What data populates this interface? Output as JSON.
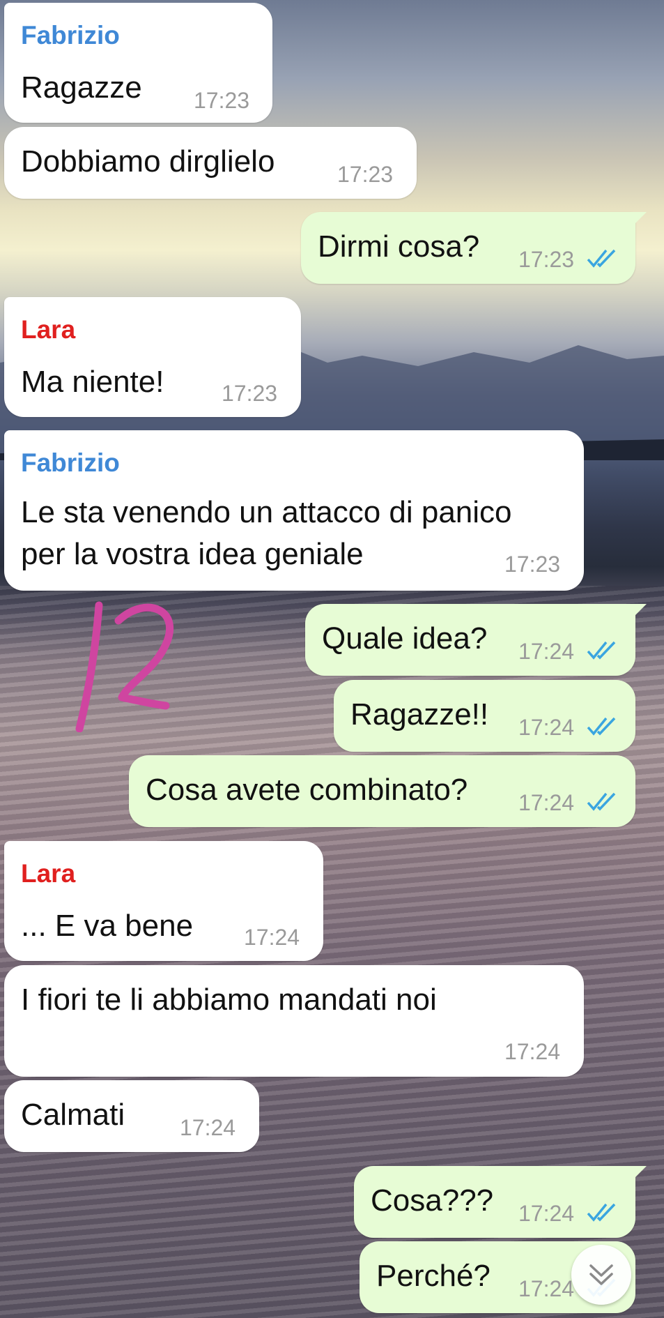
{
  "colors": {
    "fabrizio": "#3f88d6",
    "lara": "#e0201f",
    "incoming_bubble": "#ffffff",
    "outgoing_bubble": "#e7fcd5",
    "read_ticks": "#3aa5e0",
    "annotation": "#cf45a0"
  },
  "annotation": {
    "icon": "handwritten-12-annotation"
  },
  "messages": [
    {
      "sender": "Fabrizio",
      "text": "Ragazze",
      "time": "17:23"
    },
    {
      "text": "Dobbiamo dirglielo",
      "time": "17:23"
    },
    {
      "text": "Dirmi cosa?",
      "time": "17:23",
      "status": "read"
    },
    {
      "sender": "Lara",
      "text": "Ma niente!",
      "time": "17:23"
    },
    {
      "sender": "Fabrizio",
      "line1": "Le sta venendo un attacco di panico",
      "line2": "per la vostra idea geniale",
      "time": "17:23"
    },
    {
      "text": "Quale idea?",
      "time": "17:24",
      "status": "read"
    },
    {
      "text": "Ragazze!!",
      "time": "17:24",
      "status": "read"
    },
    {
      "text": "Cosa avete combinato?",
      "time": "17:24",
      "status": "read"
    },
    {
      "sender": "Lara",
      "text": "... E va bene",
      "time": "17:24"
    },
    {
      "text": "I fiori te li abbiamo mandati noi",
      "time": "17:24"
    },
    {
      "text": "Calmati",
      "time": "17:24"
    },
    {
      "text": "Cosa???",
      "time": "17:24",
      "status": "read"
    },
    {
      "text": "Perché?",
      "time": "17:24",
      "status": "read"
    }
  ],
  "scroll_button": {
    "icon": "double-chevron-down-icon"
  }
}
